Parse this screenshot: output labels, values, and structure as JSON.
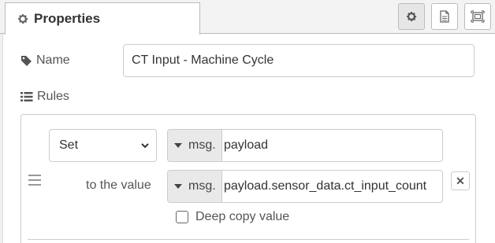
{
  "tab": {
    "label": "Properties",
    "icon": "gear-icon"
  },
  "toolbar": {
    "buttons": [
      {
        "name": "settings-tab-button",
        "icon": "gear-icon",
        "active": true
      },
      {
        "name": "description-tab-button",
        "icon": "document-icon",
        "active": false
      },
      {
        "name": "appearance-tab-button",
        "icon": "frame-icon",
        "active": false
      }
    ]
  },
  "name_field": {
    "label": "Name",
    "value": "CT Input - Machine Cycle",
    "icon": "tag-icon"
  },
  "rules": {
    "label": "Rules",
    "icon": "list-icon",
    "items": [
      {
        "action": "Set",
        "target_type": "msg.",
        "target_value": "payload",
        "to_label": "to the value",
        "source_type": "msg.",
        "source_value": "payload.sensor_data.ct_input_count",
        "deep_copy_label": "Deep copy value",
        "deep_copy_checked": false
      }
    ]
  }
}
